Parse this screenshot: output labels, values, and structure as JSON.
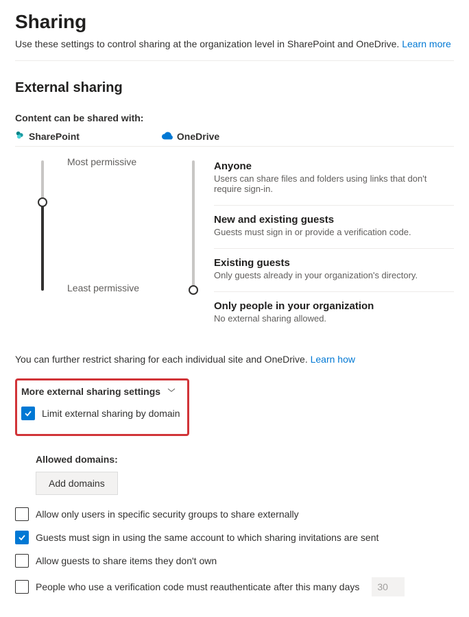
{
  "header": {
    "title": "Sharing",
    "description": "Use these settings to control sharing at the organization level in SharePoint and OneDrive.",
    "learn_more": "Learn more"
  },
  "section": {
    "title": "External sharing",
    "subhead": "Content can be shared with:",
    "products": {
      "sharepoint": "SharePoint",
      "onedrive": "OneDrive"
    },
    "labels": {
      "most": "Most permissive",
      "least": "Least permissive"
    },
    "levels": [
      {
        "title": "Anyone",
        "desc": "Users can share files and folders using links that don't require sign-in."
      },
      {
        "title": "New and existing guests",
        "desc": "Guests must sign in or provide a verification code."
      },
      {
        "title": "Existing guests",
        "desc": "Only guests already in your organization's directory."
      },
      {
        "title": "Only people in your organization",
        "desc": "No external sharing allowed."
      }
    ],
    "restrict_note": "You can further restrict sharing for each individual site and OneDrive.",
    "learn_how": "Learn how"
  },
  "more": {
    "header": "More external sharing settings",
    "limit_domain": "Limit external sharing by domain",
    "allowed_domains_label": "Allowed domains:",
    "add_domains_btn": "Add domains",
    "options": {
      "security_groups": "Allow only users in specific security groups to share externally",
      "same_account": "Guests must sign in using the same account to which sharing invitations are sent",
      "guests_share": "Allow guests to share items they don't own",
      "reauth": "People who use a verification code must reauthenticate after this many days",
      "reauth_days": "30"
    }
  }
}
